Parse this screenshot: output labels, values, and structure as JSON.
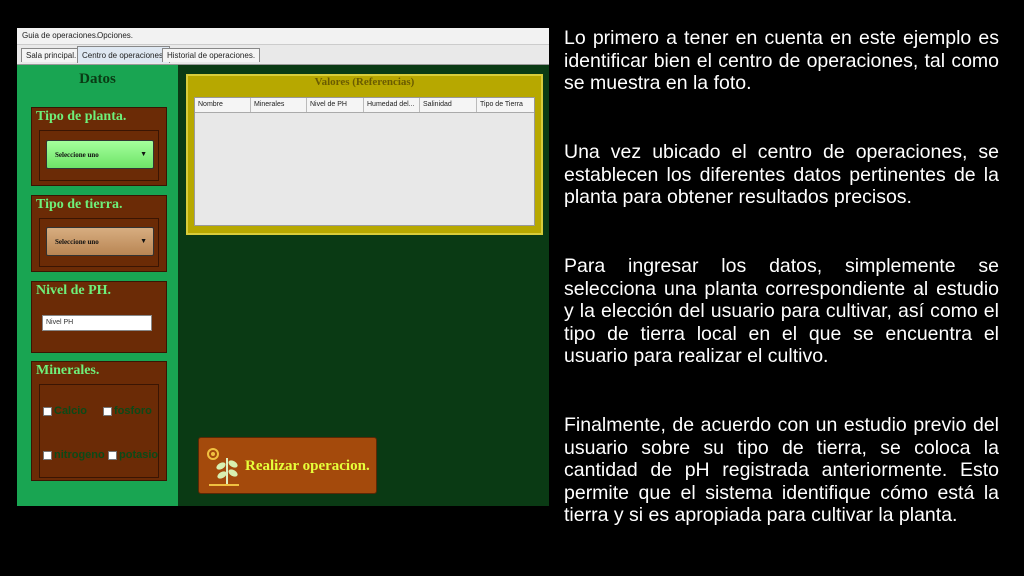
{
  "app": {
    "menu": [
      "Guia de operaciones.",
      "Opciones."
    ],
    "tabs": [
      "Sala principal.",
      "Centro de operaciones.",
      "Historial de operaciones."
    ],
    "datos_title": "Datos",
    "tipo_planta": {
      "title": "Tipo de planta.",
      "combo": "Seleccione uno"
    },
    "tipo_tierra": {
      "title": "Tipo de tierra.",
      "combo": "Seleccione uno"
    },
    "nivel_ph": {
      "title": "Nivel de PH.",
      "input_value": "Nivel PH"
    },
    "minerales": {
      "title": "Minerales.",
      "options": [
        "Calcio",
        "fosforo",
        "nitrogeno",
        "potasio"
      ]
    },
    "valores": {
      "title": "Valores (Referencias)",
      "columns": [
        "Nombre",
        "Minerales",
        "Nivel de PH",
        "Humedad del...",
        "Salinidad",
        "Tipo de Tierra"
      ]
    },
    "action_button": "Realizar operacion."
  },
  "paragraphs": [
    "Lo primero a tener en cuenta en este ejemplo es identificar bien el centro de operaciones, tal como se muestra en la foto.",
    "Una vez ubicado el centro de operaciones, se establecen los diferentes datos pertinentes de la planta para obtener resultados precisos.",
    "Para ingresar los datos, simplemente se selecciona una planta correspondiente al estudio y la elección del usuario para cultivar, así como el tipo de tierra local en el que se encuentra el usuario para realizar el cultivo.",
    "Finalmente, de acuerdo con un estudio previo del usuario sobre su tipo de tierra, se coloca la cantidad de pH registrada anteriormente. Esto permite que el sistema identifique cómo está la tierra y si es apropiada para cultivar la planta."
  ],
  "colors": {
    "panel_green": "#19a552",
    "brown": "#6b2b06",
    "label_green": "#6ef07a",
    "dark_bg": "#0a3a14"
  }
}
